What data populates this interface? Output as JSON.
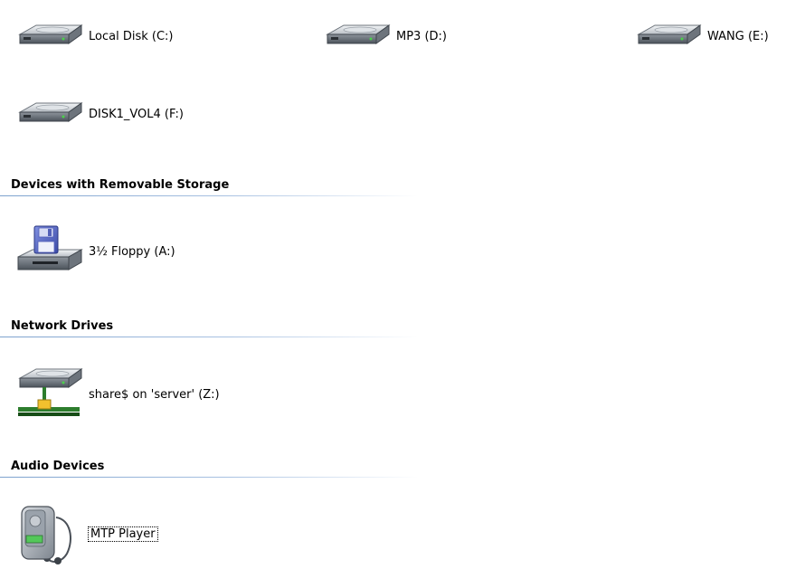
{
  "hard_disk_drives": [
    {
      "label": "Local Disk (C:)",
      "icon": "hard-drive-icon"
    },
    {
      "label": "MP3 (D:)",
      "icon": "hard-drive-icon"
    },
    {
      "label": "WANG (E:)",
      "icon": "hard-drive-icon"
    },
    {
      "label": "DISK1_VOL4 (F:)",
      "icon": "hard-drive-icon"
    }
  ],
  "groups": {
    "removable": {
      "title": "Devices with Removable Storage",
      "items": [
        {
          "label": "3½ Floppy (A:)",
          "icon": "floppy-drive-icon"
        }
      ]
    },
    "network": {
      "title": "Network Drives",
      "items": [
        {
          "label": "share$ on 'server' (Z:)",
          "icon": "network-drive-icon"
        }
      ]
    },
    "audio": {
      "title": "Audio Devices",
      "items": [
        {
          "label": "MTP Player",
          "icon": "media-player-icon",
          "focused": true
        }
      ]
    }
  },
  "colors": {
    "group_rule": "#7da2ce",
    "text": "#000000",
    "background": "#ffffff"
  }
}
